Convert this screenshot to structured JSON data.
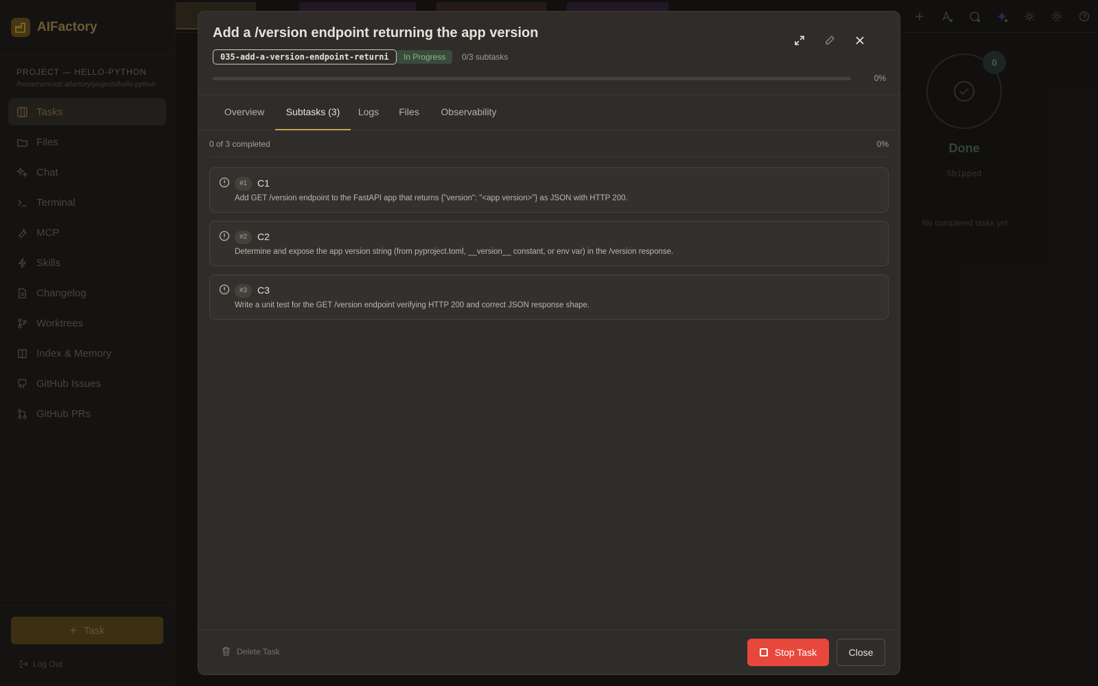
{
  "app": {
    "name": "AIFactory"
  },
  "project": {
    "label": "PROJECT — HELLO-PYTHON",
    "path": "/home/nonroot/.aifactory/projects/hello-python"
  },
  "sidebar": {
    "items": [
      {
        "label": "Tasks",
        "icon": "kanban-icon",
        "active": true
      },
      {
        "label": "Files",
        "icon": "folder-icon"
      },
      {
        "label": "Chat",
        "icon": "sparkle-icon"
      },
      {
        "label": "Terminal",
        "icon": "terminal-icon"
      },
      {
        "label": "MCP",
        "icon": "wrench-icon"
      },
      {
        "label": "Skills",
        "icon": "lightning-icon"
      },
      {
        "label": "Changelog",
        "icon": "document-icon"
      },
      {
        "label": "Worktrees",
        "icon": "git-branch-icon"
      },
      {
        "label": "Index & Memory",
        "icon": "book-icon"
      },
      {
        "label": "GitHub Issues",
        "icon": "github-icon"
      },
      {
        "label": "GitHub PRs",
        "icon": "git-pull-request-icon"
      }
    ],
    "new_task_label": "Task",
    "logout_label": "Log Out"
  },
  "board": {
    "done_column": {
      "count": "0",
      "title": "Done",
      "subtitle": "Shipped",
      "empty": "No completed tasks yet"
    }
  },
  "modal": {
    "title": "Add a /version endpoint returning the app version",
    "task_id": "035-add-a-version-endpoint-returni",
    "status": "In Progress",
    "subtask_summary": "0/3 subtasks",
    "progress": 0,
    "progress_label": "0%",
    "tabs": [
      {
        "label": "Overview"
      },
      {
        "label": "Subtasks (3)",
        "active": true
      },
      {
        "label": "Logs"
      },
      {
        "label": "Files"
      },
      {
        "label": "Observability"
      }
    ],
    "completed_summary": "0 of 3 completed",
    "completed_pct": "0%",
    "subtasks": [
      {
        "num": "#1",
        "title": "C1",
        "desc": "Add GET /version endpoint to the FastAPI app that returns {\"version\": \"<app version>\"} as JSON with HTTP 200."
      },
      {
        "num": "#2",
        "title": "C2",
        "desc": "Determine and expose the app version string (from pyproject.toml, __version__ constant, or env var) in the /version response."
      },
      {
        "num": "#3",
        "title": "C3",
        "desc": "Write a unit test for the GET /version endpoint verifying HTTP 200 and correct JSON response shape."
      }
    ],
    "footer": {
      "delete_label": "Delete Task",
      "stop_label": "Stop Task",
      "close_label": "Close"
    }
  },
  "colors": {
    "accent": "#c7a24e",
    "stop": "#e8483b",
    "status_green": "#86b98c"
  }
}
